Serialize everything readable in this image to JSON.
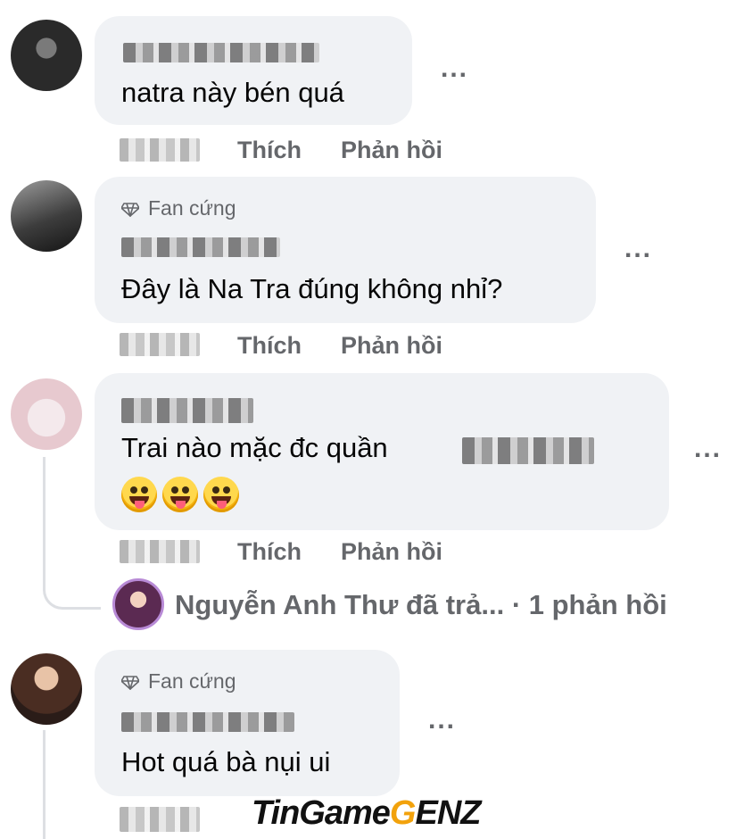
{
  "comments": [
    {
      "text": "natra này bén quá",
      "like": "Thích",
      "reply": "Phản hồi",
      "more": "..."
    },
    {
      "badge": "Fan cứng",
      "text": "Đây là Na Tra đúng không nhỉ?",
      "like": "Thích",
      "reply": "Phản hồi",
      "more": "..."
    },
    {
      "text": "Trai nào mặc đc quần",
      "like": "Thích",
      "reply": "Phản hồi",
      "more": "..."
    },
    {
      "badge": "Fan cứng",
      "text": "Hot quá bà nụi ui",
      "more": "..."
    }
  ],
  "reply_summary": "Nguyễn Anh Thư đã trả... · 1 phản hồi",
  "watermark": {
    "part1": "TinGame",
    "part2": "G",
    "part3": "ENZ"
  },
  "icons": [
    "diamond-icon",
    "more-icon",
    "emoji-tongue-icon"
  ]
}
